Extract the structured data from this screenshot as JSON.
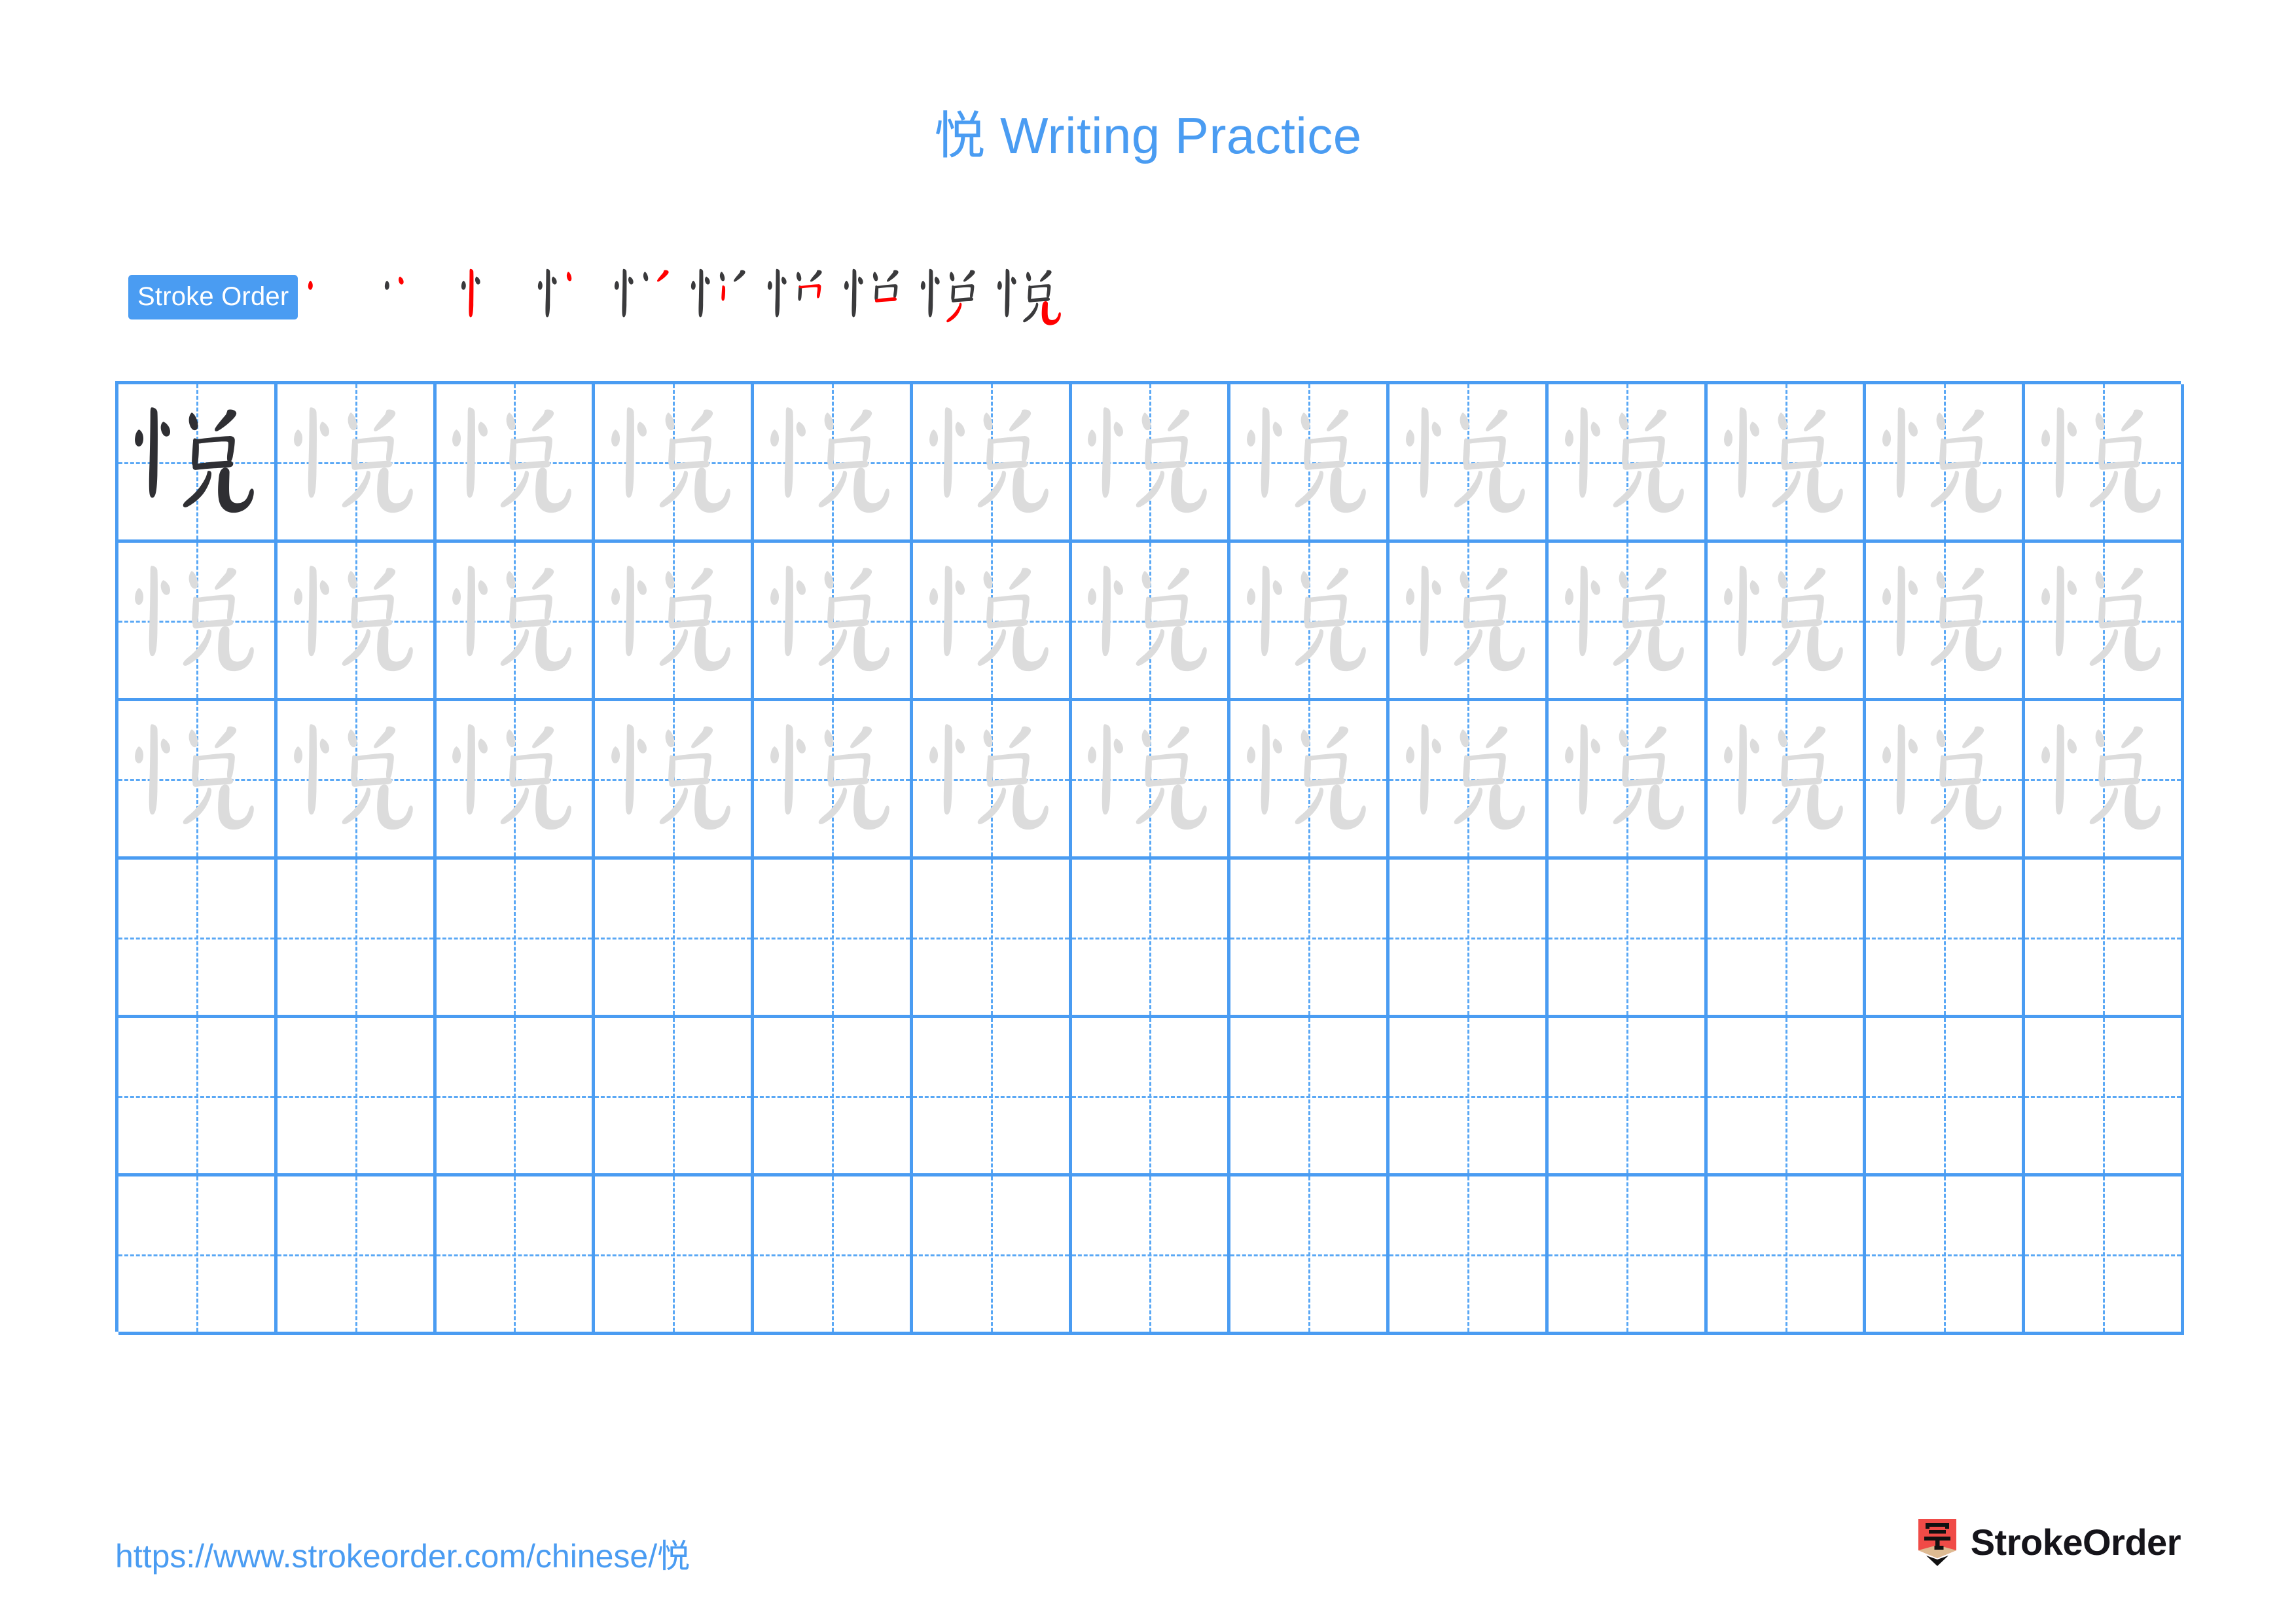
{
  "character": "悦",
  "page": {
    "title": "悦 Writing Practice",
    "title_color": "#4A9CF2",
    "background": "#ffffff"
  },
  "stroke_order": {
    "badge_label": "Stroke Order",
    "badge_bg": "#4A9CF2",
    "badge_text_color": "#ffffff",
    "total_strokes": 10,
    "previous_stroke_color": "#3A3A3C",
    "new_stroke_color": "#FF0000",
    "steps": [
      {
        "index": 1,
        "strokes_shown": 1,
        "new_stroke": 1
      },
      {
        "index": 2,
        "strokes_shown": 2,
        "new_stroke": 2
      },
      {
        "index": 3,
        "strokes_shown": 3,
        "new_stroke": 3
      },
      {
        "index": 4,
        "strokes_shown": 4,
        "new_stroke": 4
      },
      {
        "index": 5,
        "strokes_shown": 5,
        "new_stroke": 5
      },
      {
        "index": 6,
        "strokes_shown": 6,
        "new_stroke": 6
      },
      {
        "index": 7,
        "strokes_shown": 7,
        "new_stroke": 7
      },
      {
        "index": 8,
        "strokes_shown": 8,
        "new_stroke": 8
      },
      {
        "index": 9,
        "strokes_shown": 9,
        "new_stroke": 9
      },
      {
        "index": 10,
        "strokes_shown": 10,
        "new_stroke": 10
      }
    ]
  },
  "practice_grid": {
    "columns": 13,
    "rows": 6,
    "line_color": "#4A9CF2",
    "guide_color": "#5AA8F5",
    "model_glyph_color": "#2F2F33",
    "trace_glyph_color": "#DCDCDC",
    "cells": [
      [
        "model",
        "trace",
        "trace",
        "trace",
        "trace",
        "trace",
        "trace",
        "trace",
        "trace",
        "trace",
        "trace",
        "trace",
        "trace"
      ],
      [
        "trace",
        "trace",
        "trace",
        "trace",
        "trace",
        "trace",
        "trace",
        "trace",
        "trace",
        "trace",
        "trace",
        "trace",
        "trace"
      ],
      [
        "trace",
        "trace",
        "trace",
        "trace",
        "trace",
        "trace",
        "trace",
        "trace",
        "trace",
        "trace",
        "trace",
        "trace",
        "trace"
      ],
      [
        "empty",
        "empty",
        "empty",
        "empty",
        "empty",
        "empty",
        "empty",
        "empty",
        "empty",
        "empty",
        "empty",
        "empty",
        "empty"
      ],
      [
        "empty",
        "empty",
        "empty",
        "empty",
        "empty",
        "empty",
        "empty",
        "empty",
        "empty",
        "empty",
        "empty",
        "empty",
        "empty"
      ],
      [
        "empty",
        "empty",
        "empty",
        "empty",
        "empty",
        "empty",
        "empty",
        "empty",
        "empty",
        "empty",
        "empty",
        "empty",
        "empty"
      ]
    ]
  },
  "footer": {
    "url": "https://www.strokeorder.com/chinese/悦",
    "url_color": "#4A9CF2",
    "brand_name": "StrokeOrder",
    "brand_glyph": "字",
    "brand_mark_color": "#F04B47",
    "brand_mark_tip_color": "#DDBB92"
  }
}
